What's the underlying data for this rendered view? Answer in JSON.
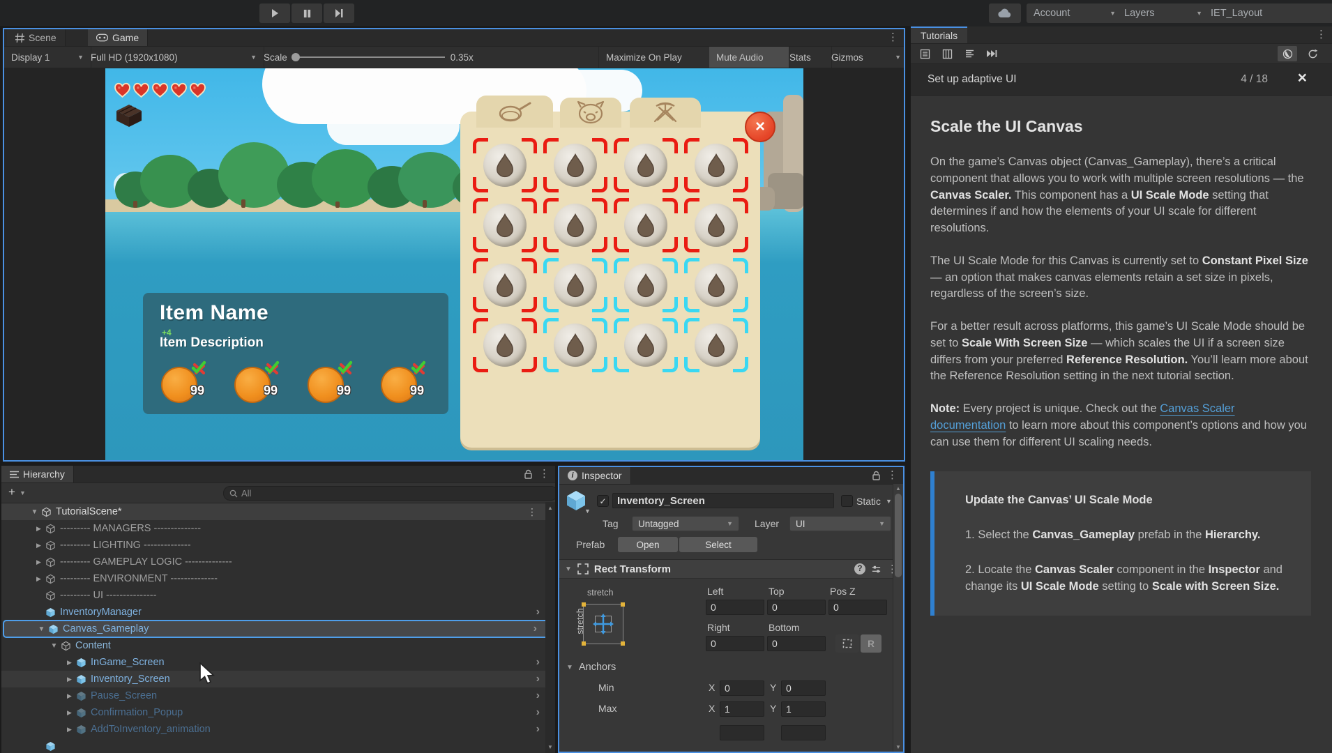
{
  "topbar": {
    "account_label": "Account",
    "layers_label": "Layers",
    "layout_label": "IET_Layout"
  },
  "game_panel": {
    "scene_tab": "Scene",
    "game_tab": "Game",
    "toolbar": {
      "display": "Display 1",
      "resolution": "Full HD (1920x1080)",
      "scale_label": "Scale",
      "scale_value": "0.35x",
      "maximize_label": "Maximize On Play",
      "mute_label": "Mute Audio",
      "stats_label": "Stats",
      "gizmos_label": "Gizmos"
    },
    "hud": {
      "hearts": 5
    },
    "inventory": {
      "tabs": [
        "pan-tab",
        "pig-tab",
        "tools-tab"
      ],
      "grid_corner_colors": [
        [
          "red",
          "red",
          "red",
          "red"
        ],
        [
          "red",
          "red",
          "red",
          "red"
        ],
        [
          "red",
          "cyan",
          "cyan",
          "cyan"
        ],
        [
          "red",
          "cyan",
          "cyan",
          "cyan"
        ]
      ]
    },
    "item_panel": {
      "name": "Item Name",
      "bonus": "+4",
      "description": "Item Description",
      "slots": [
        {
          "count": "99"
        },
        {
          "count": "99"
        },
        {
          "count": "99"
        },
        {
          "count": "99"
        }
      ]
    }
  },
  "hierarchy": {
    "tab_label": "Hierarchy",
    "search_placeholder": "All",
    "items": [
      {
        "label": "TutorialScene*",
        "type": "scene",
        "arrow": "expanded",
        "level": 0,
        "kebab": true
      },
      {
        "label": "--------- MANAGERS --------------",
        "type": "group",
        "arrow": "collapsed",
        "level": 1
      },
      {
        "label": "--------- LIGHTING --------------",
        "type": "group",
        "arrow": "collapsed",
        "level": 1
      },
      {
        "label": "--------- GAMEPLAY LOGIC --------------",
        "type": "group",
        "arrow": "collapsed",
        "level": 1
      },
      {
        "label": "--------- ENVIRONMENT --------------",
        "type": "group",
        "arrow": "collapsed",
        "level": 1
      },
      {
        "label": "--------- UI ---------------",
        "type": "group",
        "arrow": "none",
        "level": 1
      },
      {
        "label": "InventoryManager",
        "type": "prefab",
        "arrow": "none",
        "level": 1,
        "chevron": true
      },
      {
        "label": "Canvas_Gameplay",
        "type": "prefab",
        "arrow": "expanded",
        "level": 1,
        "chevron": true,
        "selected": true
      },
      {
        "label": "Content",
        "type": "object",
        "arrow": "expanded",
        "level": 2
      },
      {
        "label": "InGame_Screen",
        "type": "prefab",
        "arrow": "collapsed",
        "level": 3,
        "chevron": true
      },
      {
        "label": "Inventory_Screen",
        "type": "prefab",
        "arrow": "collapsed",
        "level": 3,
        "chevron": true,
        "hover": true
      },
      {
        "label": "Pause_Screen",
        "type": "disabled",
        "arrow": "collapsed",
        "level": 3,
        "chevron": true
      },
      {
        "label": "Confirmation_Popup",
        "type": "disabled",
        "arrow": "collapsed",
        "level": 3,
        "chevron": true
      },
      {
        "label": "AddToInventory_animation",
        "type": "disabled",
        "arrow": "collapsed",
        "level": 3,
        "chevron": true
      },
      {
        "label": "",
        "type": "prefab",
        "arrow": "none",
        "level": 1
      }
    ]
  },
  "inspector": {
    "tab_label": "Inspector",
    "object_name": "Inventory_Screen",
    "static_label": "Static",
    "tag_label": "Tag",
    "tag_value": "Untagged",
    "layer_label": "Layer",
    "layer_value": "UI",
    "prefab_label": "Prefab",
    "open_label": "Open",
    "select_label": "Select",
    "rect_transform": {
      "title": "Rect Transform",
      "stretch_h": "stretch",
      "stretch_v": "stretch",
      "left_label": "Left",
      "top_label": "Top",
      "posz_label": "Pos Z",
      "right_label": "Right",
      "bottom_label": "Bottom",
      "left": "0",
      "top": "0",
      "posz": "0",
      "right": "0",
      "bottom": "0",
      "r_button": "R",
      "anchors_label": "Anchors",
      "min_label": "Min",
      "max_label": "Max",
      "x_label": "X",
      "y_label": "Y",
      "min_x": "0",
      "min_y": "0",
      "max_x": "1",
      "max_y": "1"
    }
  },
  "tutorials": {
    "tab_label": "Tutorials",
    "header": "Set up adaptive UI",
    "progress": "4 / 18",
    "close_glyph": "×",
    "title": "Scale the UI Canvas",
    "paragraphs": [
      [
        {
          "t": "On the game’s Canvas object (Canvas_Gameplay), there’s a critical component that allows you to work with multiple screen resolutions — the "
        },
        {
          "b": "Canvas Scaler."
        },
        {
          "t": " This component has a "
        },
        {
          "b": "UI Scale Mode"
        },
        {
          "t": " setting that determines if and how the elements of your UI scale for different resolutions."
        }
      ],
      [
        {
          "t": "The UI Scale Mode for this Canvas is currently set to "
        },
        {
          "b": "Constant Pixel Size"
        },
        {
          "t": " — an option that makes canvas elements retain a set size in pixels, regardless of the screen’s size."
        }
      ],
      [
        {
          "t": "For a better result across platforms, this game’s UI Scale Mode should be set to "
        },
        {
          "b": "Scale With Screen Size"
        },
        {
          "t": " — which scales the UI if a screen size differs from your preferred "
        },
        {
          "b": "Reference Resolution."
        },
        {
          "t": " You’ll learn more about the Reference Resolution setting in the next tutorial section."
        }
      ],
      [
        {
          "b": "Note:"
        },
        {
          "t": " Every project is unique. Check out the "
        },
        {
          "a": "Canvas Scaler documentation"
        },
        {
          "t": " to learn more about this component’s options and how you can use them for different UI scaling needs."
        }
      ]
    ],
    "callout": {
      "title": "Update the Canvas’ UI Scale Mode",
      "steps": [
        [
          {
            "t": "1. Select the "
          },
          {
            "b": "Canvas_Gameplay"
          },
          {
            "t": " prefab in the "
          },
          {
            "b": "Hierarchy."
          }
        ],
        [
          {
            "t": "2. Locate the "
          },
          {
            "b": "Canvas Scaler"
          },
          {
            "t": " component in the "
          },
          {
            "b": "Inspector"
          },
          {
            "t": " and change its "
          },
          {
            "b": "UI Scale Mode"
          },
          {
            "t": " setting to "
          },
          {
            "b": "Scale with Screen Size."
          }
        ]
      ]
    }
  }
}
